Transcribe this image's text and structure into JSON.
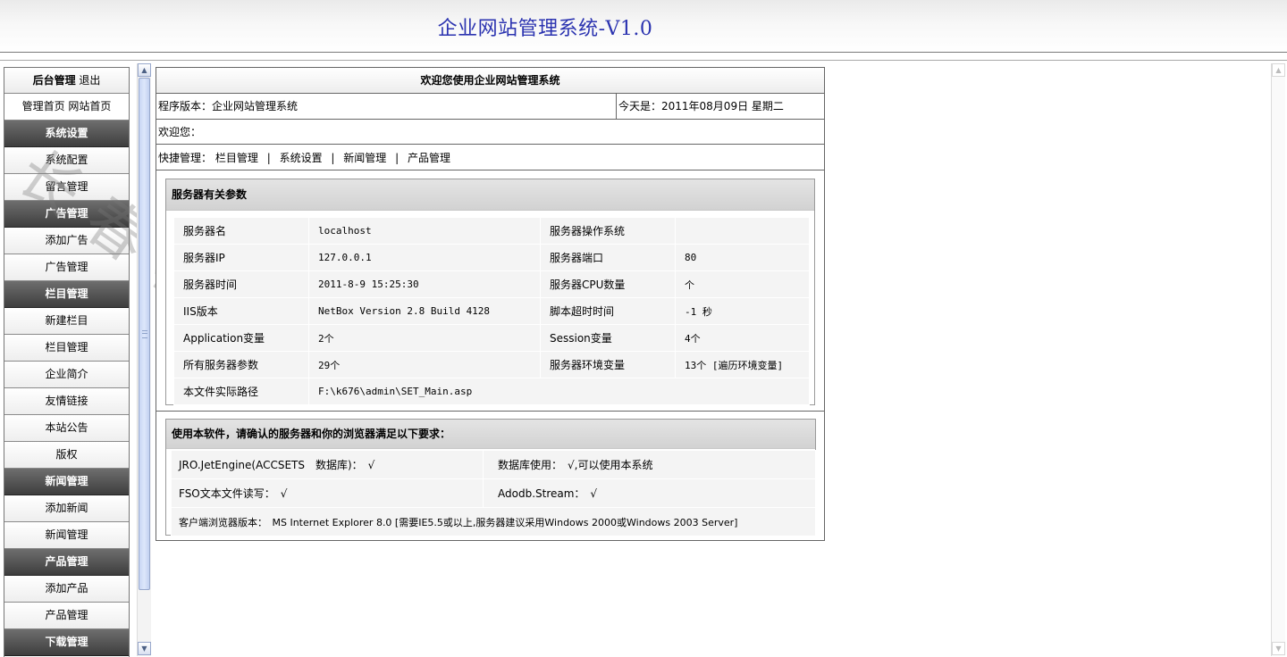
{
  "header": {
    "title": "企业网站管理系统-V1.0"
  },
  "sidebar": {
    "top_bold": "后台管理",
    "top_link": "退出",
    "links": [
      "管理首页",
      "网站首页"
    ],
    "sections": [
      {
        "title": "系统设置",
        "items": [
          "系统配置",
          "留言管理"
        ]
      },
      {
        "title": "广告管理",
        "items": [
          "添加广告",
          "广告管理"
        ]
      },
      {
        "title": "栏目管理",
        "items": [
          "新建栏目",
          "栏目管理",
          "企业简介",
          "友情链接",
          "本站公告",
          "版权"
        ]
      },
      {
        "title": "新闻管理",
        "items": [
          "添加新闻",
          "新闻管理"
        ]
      },
      {
        "title": "产品管理",
        "items": [
          "添加产品",
          "产品管理"
        ]
      },
      {
        "title": "下载管理",
        "items": []
      }
    ]
  },
  "main": {
    "welcome": "欢迎您使用企业网站管理系统",
    "version": "程序版本：企业网站管理系统",
    "today": "今天是：2011年08月09日 星期二",
    "hello": "欢迎您：",
    "quick_label": "快捷管理：",
    "quick_links": [
      "栏目管理",
      "系统设置",
      "新闻管理",
      "产品管理"
    ],
    "quick_sep": "|",
    "server": {
      "title": "服务器有关参数",
      "rows": [
        [
          "服务器名",
          "localhost",
          "服务器操作系统",
          ""
        ],
        [
          "服务器IP",
          "127.0.0.1",
          "服务器端口",
          "80"
        ],
        [
          "服务器时间",
          "2011-8-9 15:25:30",
          "服务器CPU数量",
          "个"
        ],
        [
          "IIS版本",
          "NetBox Version 2.8 Build 4128",
          "脚本超时时间",
          "-1 秒"
        ],
        [
          "Application变量",
          "2个",
          "Session变量",
          "4个"
        ],
        [
          "所有服务器参数",
          "29个",
          "服务器环境变量",
          "13个 [遍历环境变量]"
        ]
      ],
      "path_label": "本文件实际路径",
      "path_value": "F:\\k676\\admin\\SET_Main.asp"
    },
    "requirements": {
      "title": "使用本软件，请确认的服务器和你的浏览器满足以下要求：",
      "jro": "JRO.JetEngine(ACCSETS　数据库)：　√",
      "db": "数据库使用：　√,可以使用本系统",
      "fso": "FSO文本文件读写：　√",
      "adodb": "Adodb.Stream：　√",
      "client": "客户端浏览器版本：　MS Internet Explorer 8.0 [需要IE5.5或以上,服务器建议采用Windows 2000或Windows 2003 Server]"
    }
  },
  "watermark": "长春树网络"
}
